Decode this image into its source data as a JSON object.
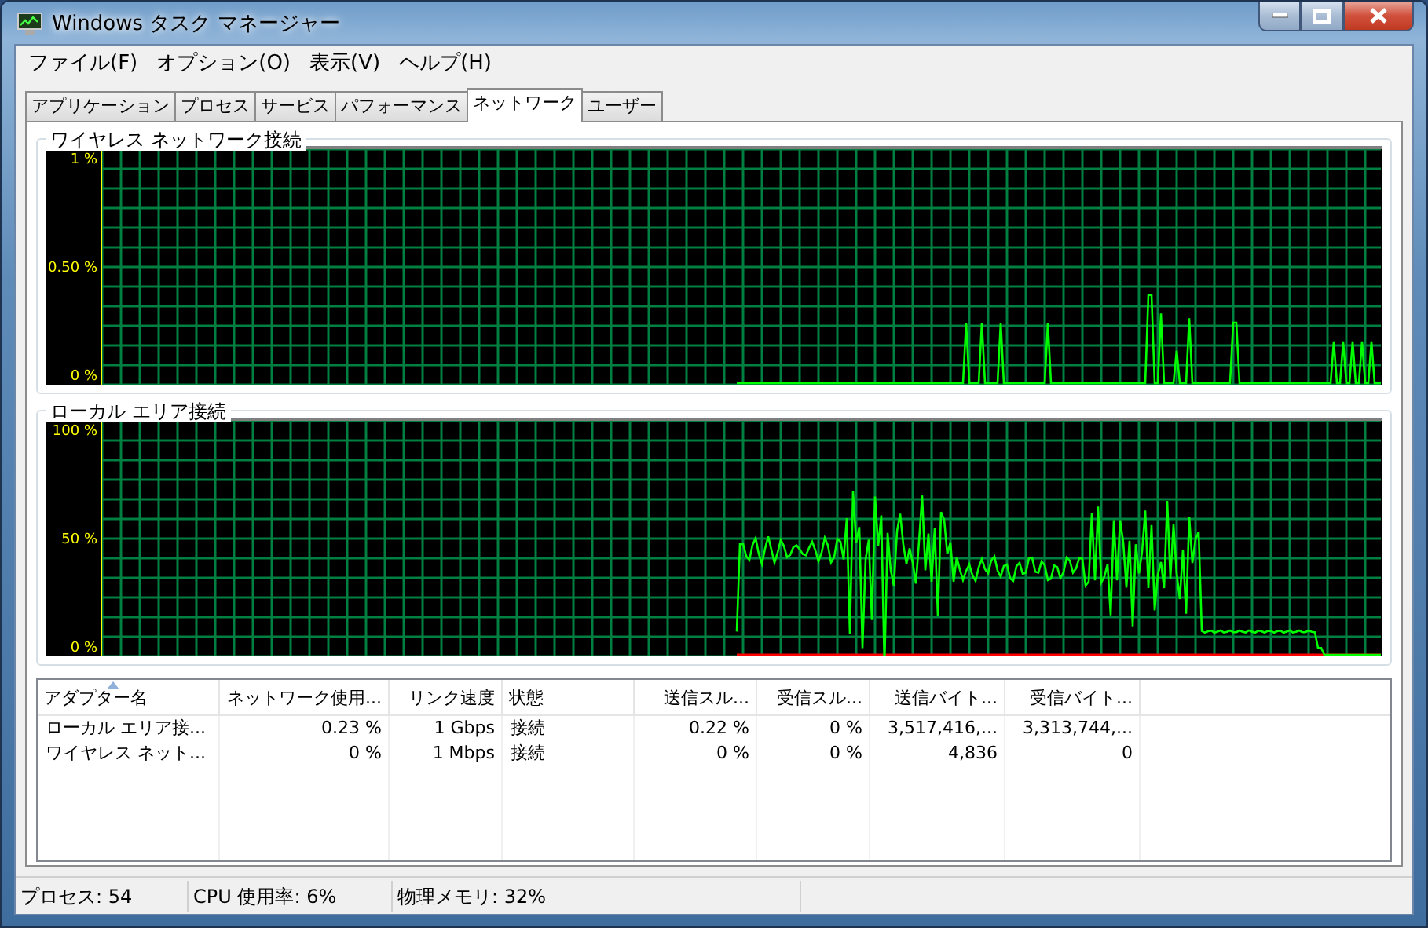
{
  "window": {
    "title": "Windows タスク マネージャー"
  },
  "menu": [
    "ファイル(F)",
    "オプション(O)",
    "表示(V)",
    "ヘルプ(H)"
  ],
  "tabs": [
    {
      "label": "アプリケーション",
      "selected": false
    },
    {
      "label": "プロセス",
      "selected": false
    },
    {
      "label": "サービス",
      "selected": false
    },
    {
      "label": "パフォーマンス",
      "selected": false
    },
    {
      "label": "ネットワーク",
      "selected": true
    },
    {
      "label": "ユーザー",
      "selected": false
    }
  ],
  "graphs": [
    {
      "title": "ワイヤレス ネットワーク接続",
      "kind": "spikes",
      "y_labels": [
        "1 %",
        "0.50 %",
        "0 %"
      ]
    },
    {
      "title": "ローカル エリア接続",
      "kind": "busy",
      "y_labels": [
        "100 %",
        "50 %",
        "0 %"
      ]
    }
  ],
  "table": {
    "columns": [
      {
        "label": "アダプター名",
        "sorted": true
      },
      {
        "label": "ネットワーク使用...",
        "sorted": false
      },
      {
        "label": "リンク速度",
        "sorted": false
      },
      {
        "label": "状態",
        "sorted": false
      },
      {
        "label": "送信スル...",
        "sorted": false
      },
      {
        "label": "受信スル...",
        "sorted": false
      },
      {
        "label": "送信バイト...",
        "sorted": false
      },
      {
        "label": "受信バイト...",
        "sorted": false
      }
    ],
    "rows": [
      [
        "ローカル エリア接...",
        "0.23 %",
        "1 Gbps",
        "接続",
        "0.22 %",
        "0 %",
        "3,517,416,...",
        "3,313,744,..."
      ],
      [
        "ワイヤレス ネット...",
        "0 %",
        "1 Mbps",
        "接続",
        "0 %",
        "0 %",
        "4,836",
        "0"
      ]
    ]
  },
  "status_bar": [
    "プロセス: 54",
    "CPU 使用率: 6%",
    "物理メモリ: 32%"
  ]
}
